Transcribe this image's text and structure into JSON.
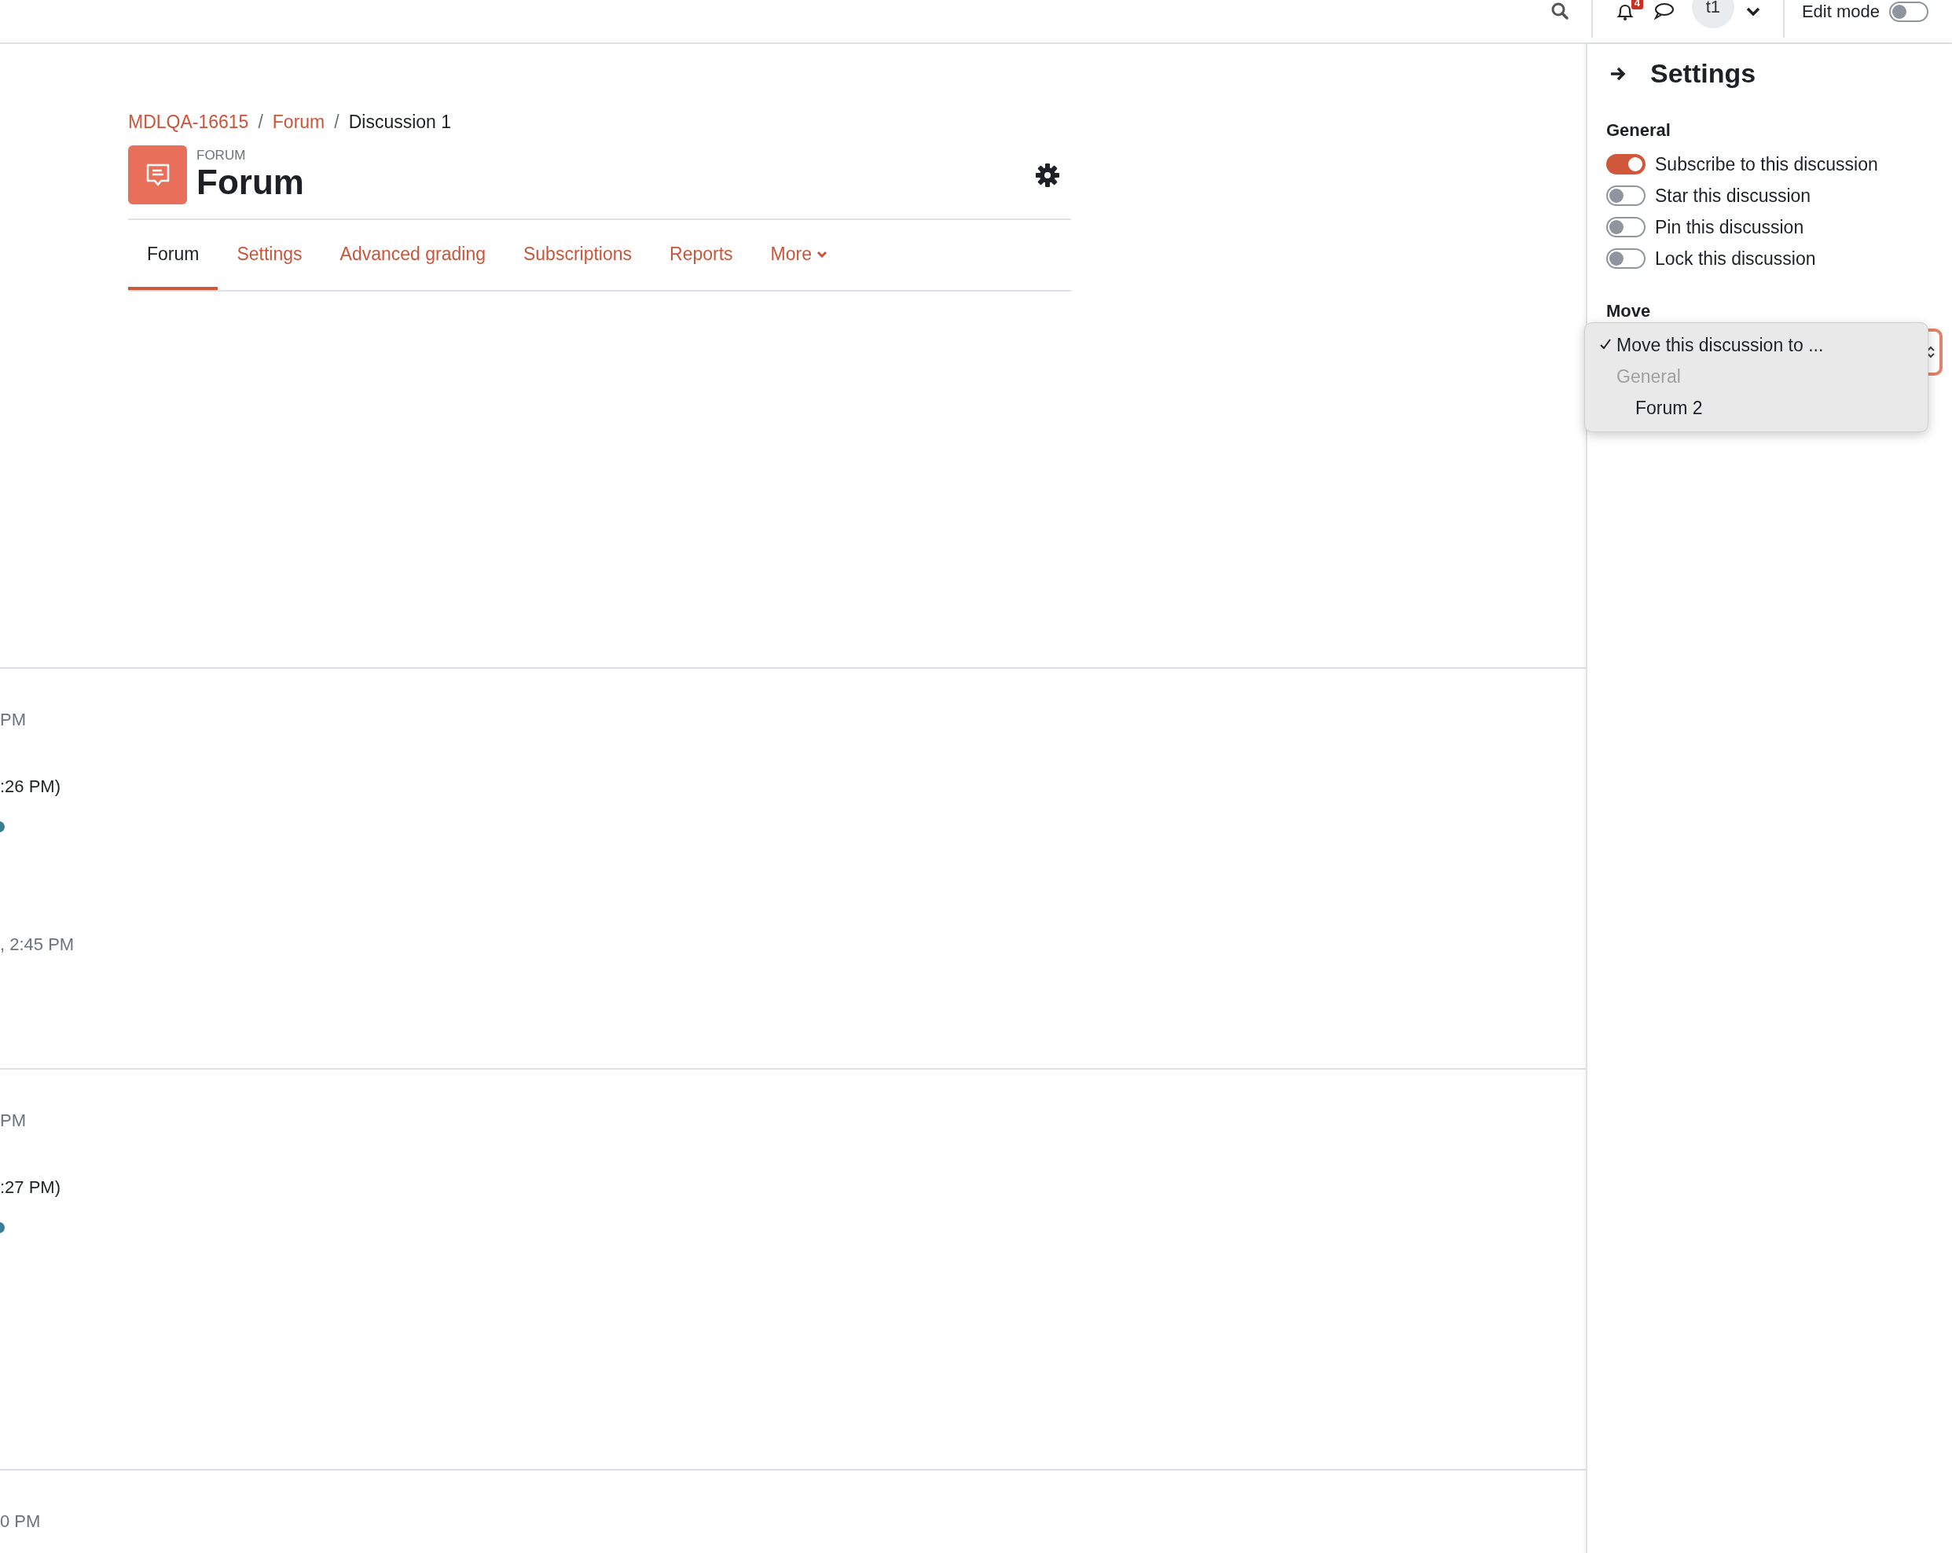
{
  "top_bar": {
    "notification_count": "4",
    "user_initials": "t1",
    "edit_mode": {
      "label": "Edit mode",
      "on": false
    }
  },
  "breadcrumb": [
    {
      "label": "MDLQA-16615",
      "link": true
    },
    {
      "separator": "/",
      "label": "Forum",
      "link": true
    },
    {
      "separator": "/",
      "label": "Discussion 1",
      "link": false
    }
  ],
  "header": {
    "kicker": "FORUM",
    "title": "Forum"
  },
  "tabs": [
    {
      "label": "Forum",
      "selected": true,
      "kind": "link"
    },
    {
      "label": "Settings",
      "selected": false,
      "kind": "link"
    },
    {
      "label": "Advanced grading",
      "selected": false,
      "kind": "link"
    },
    {
      "label": "Subscriptions",
      "selected": false,
      "kind": "link"
    },
    {
      "label": "Reports",
      "selected": false,
      "kind": "link"
    },
    {
      "label": "More",
      "selected": false,
      "kind": "menu"
    }
  ],
  "timeline": [
    {
      "meta": "PM",
      "detail": ":26 PM)",
      "time": ", 2:45 PM"
    },
    {
      "meta": "PM",
      "detail": ":27 PM)"
    },
    {
      "meta": "0 PM"
    }
  ],
  "drawer": {
    "title": "Settings",
    "sections": [
      {
        "heading": "General",
        "toggles": [
          {
            "label": "Subscribe to this discussion",
            "on": true
          },
          {
            "label": "Star this discussion",
            "on": false
          },
          {
            "label": "Pin this discussion",
            "on": false
          },
          {
            "label": "Lock this discussion",
            "on": false
          }
        ]
      }
    ],
    "move": {
      "heading": "Move",
      "options": [
        {
          "kind": "option",
          "label": "Move this discussion to ...",
          "selected": true
        },
        {
          "kind": "group",
          "label": "General",
          "children": [
            {
              "kind": "option",
              "label": "Forum 2",
              "selected": false
            }
          ]
        }
      ]
    }
  }
}
